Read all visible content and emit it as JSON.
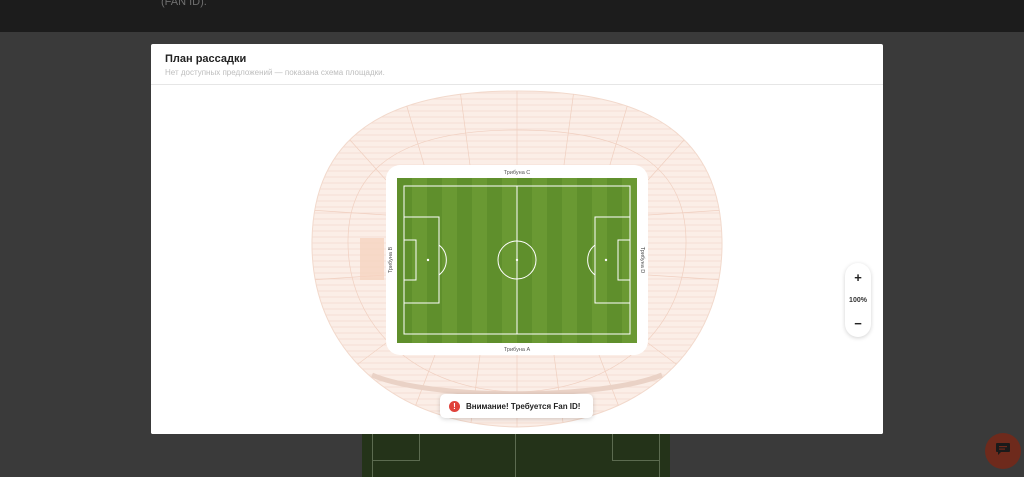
{
  "background": {
    "top_text": "(FAN ID)."
  },
  "modal": {
    "title": "План рассадки",
    "subtitle": "Нет доступных предложений — показана схема площадки."
  },
  "stands": {
    "north": "Трибуна C",
    "south": "Трибуна A",
    "west": "Трибуна B",
    "east": "Трибуна D"
  },
  "zoom": {
    "in_label": "+",
    "level": "100%",
    "out_label": "−"
  },
  "notice": {
    "icon": "!",
    "text": "Внимание! Требуется Fan ID!"
  },
  "colors": {
    "pitch_dark": "#5f8f2c",
    "pitch_light": "#79a23e",
    "seats": "#f8e0d4",
    "alert": "#e0423b",
    "chat": "#6e2a1c"
  },
  "icons": {
    "chat": "chat-icon",
    "warning": "exclamation-icon"
  }
}
